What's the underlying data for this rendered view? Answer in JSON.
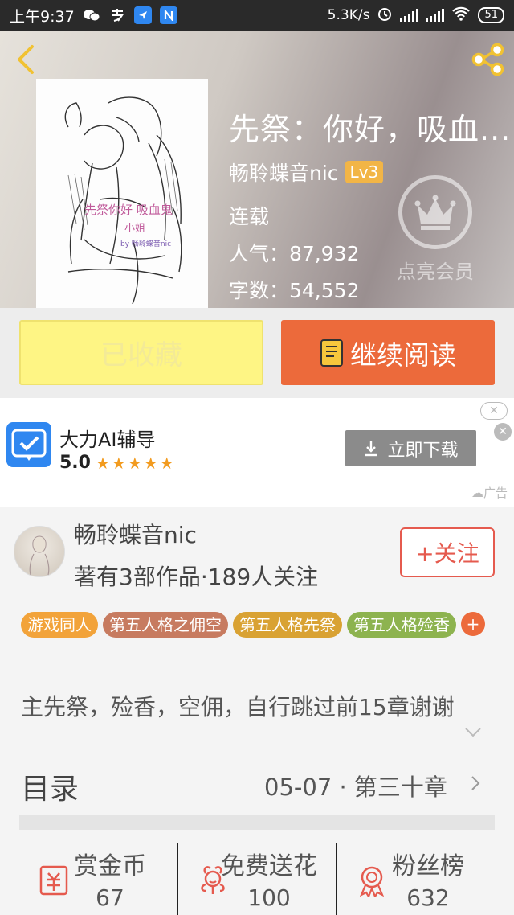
{
  "statusbar": {
    "time": "上午9:37",
    "speed": "5.3K/s",
    "battery": "51"
  },
  "book": {
    "title": "先祭：你好，吸血...",
    "author": "畅聆蝶音nic",
    "level": "Lv3",
    "status": "连载",
    "popularity": "人气：87,932",
    "word_count": "字数：54,552",
    "vip_label": "点亮会员"
  },
  "actions": {
    "favorited": "已收藏",
    "continue_reading": "继续阅读"
  },
  "ad": {
    "app_name": "大力AI辅导",
    "rating": "5.0",
    "stars": "★★★★★",
    "download": "立即下载",
    "ad_tag": "广告",
    "close": "✕"
  },
  "author_info": {
    "name": "畅聆蝶音nic",
    "summary": "著有3部作品·189人关注",
    "follow": "+关注"
  },
  "tags": [
    {
      "label": "游戏同人",
      "color": "#f2a33a"
    },
    {
      "label": "第五人格之佣空",
      "color": "#c77b60"
    },
    {
      "label": "第五人格先祭",
      "color": "#d9a233"
    },
    {
      "label": "第五人格殓香",
      "color": "#8db34f"
    }
  ],
  "tag_more": "+",
  "description": "主先祭，殓香，空佣，自行跳过前15章谢谢",
  "toc": {
    "label": "目录",
    "latest": "05-07 · 第三十章"
  },
  "stats": [
    {
      "label": "赏金币",
      "value": "67",
      "icon": "reward-coin-icon"
    },
    {
      "label": "免费送花",
      "value": "100",
      "icon": "flower-icon"
    },
    {
      "label": "粉丝榜",
      "value": "632",
      "icon": "medal-icon"
    }
  ],
  "colors": {
    "accent_orange": "#ec6a3b",
    "favorite_yellow": "#fef584",
    "follow_red": "#e55a4e",
    "level_badge": "#f2b546"
  }
}
